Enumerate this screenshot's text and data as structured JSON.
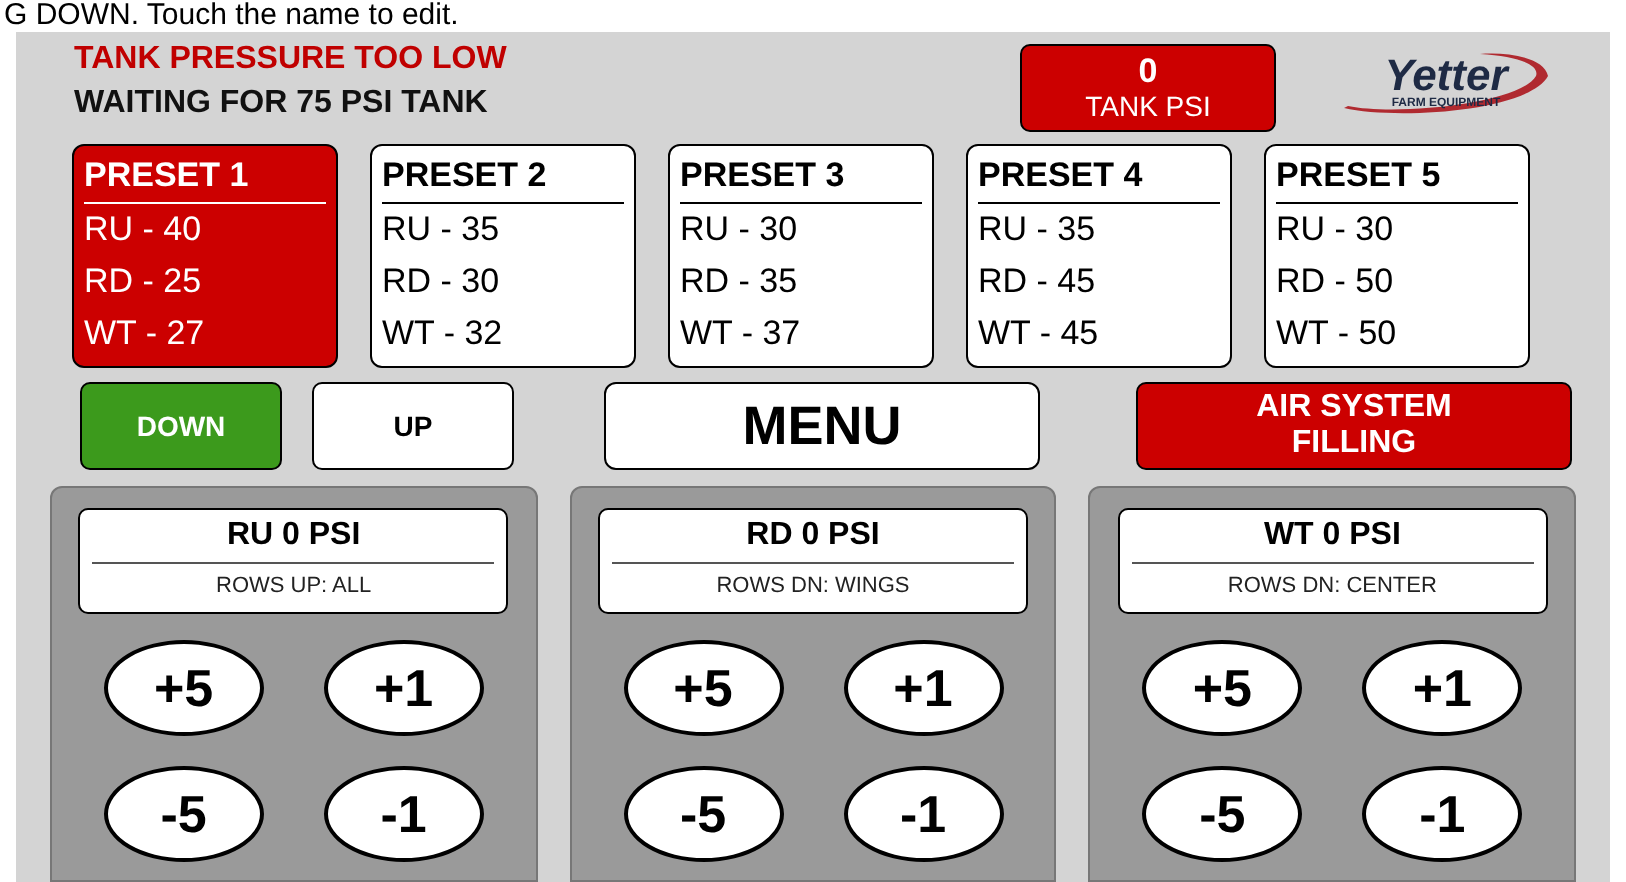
{
  "hint": "G DOWN. Touch the name to edit.",
  "status": {
    "alert": "TANK PRESSURE TOO LOW",
    "message": "WAITING FOR 75 PSI TANK"
  },
  "tank": {
    "value": "0",
    "label": "TANK PSI"
  },
  "logo": {
    "name": "Yetter",
    "tagline": "FARM EQUIPMENT"
  },
  "presets": [
    {
      "title": "PRESET 1",
      "selected": true,
      "lines": [
        "RU - 40",
        "RD - 25",
        "WT - 27"
      ]
    },
    {
      "title": "PRESET 2",
      "selected": false,
      "lines": [
        "RU - 35",
        "RD - 30",
        "WT - 32"
      ]
    },
    {
      "title": "PRESET 3",
      "selected": false,
      "lines": [
        "RU - 30",
        "RD - 35",
        "WT - 37"
      ]
    },
    {
      "title": "PRESET 4",
      "selected": false,
      "lines": [
        "RU - 35",
        "RD - 45",
        "WT - 45"
      ]
    },
    {
      "title": "PRESET 5",
      "selected": false,
      "lines": [
        "RU - 30",
        "RD - 50",
        "WT - 50"
      ]
    }
  ],
  "direction": [
    {
      "label": "DOWN",
      "selected": true
    },
    {
      "label": "UP",
      "selected": false
    }
  ],
  "menu": "MENU",
  "air_system": {
    "label": "AIR SYSTEM FILLING",
    "filling": true
  },
  "zones": [
    {
      "reading": "RU 0 PSI",
      "rows": "ROWS UP: ALL",
      "buttons": [
        "+5",
        "+1",
        "-5",
        "-1"
      ]
    },
    {
      "reading": "RD 0 PSI",
      "rows": "ROWS DN: WINGS",
      "buttons": [
        "+5",
        "+1",
        "-5",
        "-1"
      ]
    },
    {
      "reading": "WT 0 PSI",
      "rows": "ROWS DN: CENTER",
      "buttons": [
        "+5",
        "+1",
        "-5",
        "-1"
      ]
    }
  ]
}
